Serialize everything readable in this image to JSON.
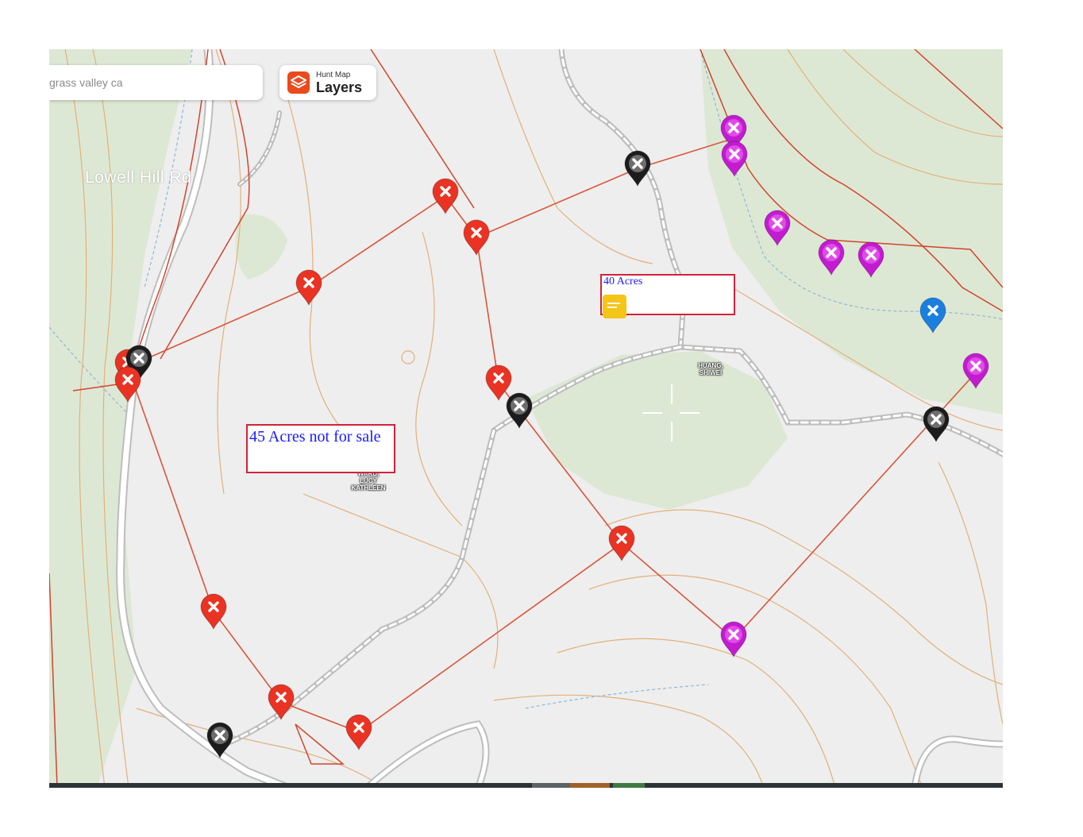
{
  "search": {
    "value": "grass valley ca"
  },
  "layers_button": {
    "subtitle": "Hunt Map",
    "label": "Layers",
    "icon": "layers-icon"
  },
  "road_label": "Lowell Hill Rd",
  "owners": [
    {
      "name": "HUANG,\nSHIWEI"
    },
    {
      "name": "WARD,\nLUCY\nKATHLEEN"
    }
  ],
  "notes": [
    {
      "text": "40 Acres",
      "icon": "comment-icon"
    },
    {
      "text": "45 Acres not for sale"
    }
  ],
  "pin_colors": {
    "red": "#ea3323",
    "black": "#1c1c1c",
    "magenta": "#c21bd0",
    "blue": "#1b7fe0"
  },
  "pins": [
    {
      "color": "red",
      "icon": "x-icon"
    },
    {
      "color": "red",
      "icon": "x-icon"
    },
    {
      "color": "red",
      "icon": "x-icon"
    },
    {
      "color": "red",
      "icon": "x-icon"
    },
    {
      "color": "red",
      "icon": "x-icon"
    },
    {
      "color": "red",
      "icon": "x-icon"
    },
    {
      "color": "red",
      "icon": "x-icon"
    },
    {
      "color": "red",
      "icon": "x-icon"
    },
    {
      "color": "red",
      "icon": "x-icon"
    },
    {
      "color": "black",
      "icon": "x-icon"
    },
    {
      "color": "black",
      "icon": "x-icon"
    },
    {
      "color": "black",
      "icon": "x-icon"
    },
    {
      "color": "black",
      "icon": "x-icon"
    },
    {
      "color": "black",
      "icon": "x-icon"
    },
    {
      "color": "magenta",
      "icon": "x-icon"
    },
    {
      "color": "magenta",
      "icon": "x-icon"
    },
    {
      "color": "magenta",
      "icon": "x-icon"
    },
    {
      "color": "magenta",
      "icon": "x-icon"
    },
    {
      "color": "magenta",
      "icon": "x-icon"
    },
    {
      "color": "magenta",
      "icon": "x-icon"
    },
    {
      "color": "magenta",
      "icon": "x-icon"
    },
    {
      "color": "blue",
      "icon": "x-icon"
    },
    {
      "color": "red",
      "icon": "x-icon"
    }
  ],
  "map_colors": {
    "background": "#eeeeee",
    "forest": "#dde8d4",
    "contour": "#e2b07a",
    "property_line": "#d9563a",
    "boundary": "#d2452d",
    "stream": "#8fb6d6"
  }
}
